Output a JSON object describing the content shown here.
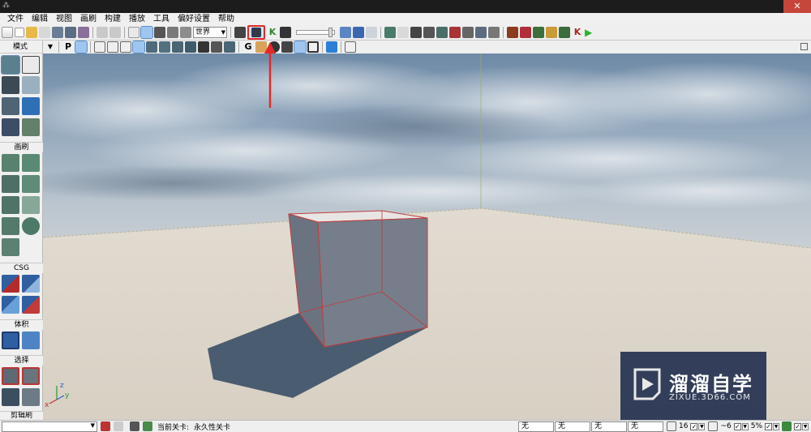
{
  "titlebar": {
    "close_glyph": "✕",
    "app_glyph": "⁂"
  },
  "menu": [
    "文件",
    "编辑",
    "视图",
    "画刷",
    "构建",
    "播放",
    "工具",
    "偏好设置",
    "帮助"
  ],
  "toolbar": {
    "coordinate_system": "世界",
    "highlighted_tool_icon": "content-browser-icon",
    "play_glyph": "▶"
  },
  "left_panel": {
    "mode_label": "模式",
    "sections": {
      "brush": "画刷",
      "csg": "CSG",
      "volume": "体积",
      "select": "选择",
      "cut": "剪辑刷"
    }
  },
  "viewport": {
    "axis_labels": {
      "x": "x",
      "y": "y",
      "z": "z"
    }
  },
  "watermark": {
    "title": "溜溜自学",
    "url": "ZIXUE.3D66.COM"
  },
  "statusbar": {
    "current_level_label": "当前关卡:",
    "current_level_value": "永久性关卡",
    "fields": [
      "无",
      "无",
      "无",
      "无"
    ],
    "grid_size": "16",
    "rotation_snap": "~6",
    "scale_snap": "5%"
  },
  "colors": {
    "annotation_red": "#e12a2a",
    "cube_edge": "#c03d3d",
    "watermark_bg": "#202d4e"
  }
}
